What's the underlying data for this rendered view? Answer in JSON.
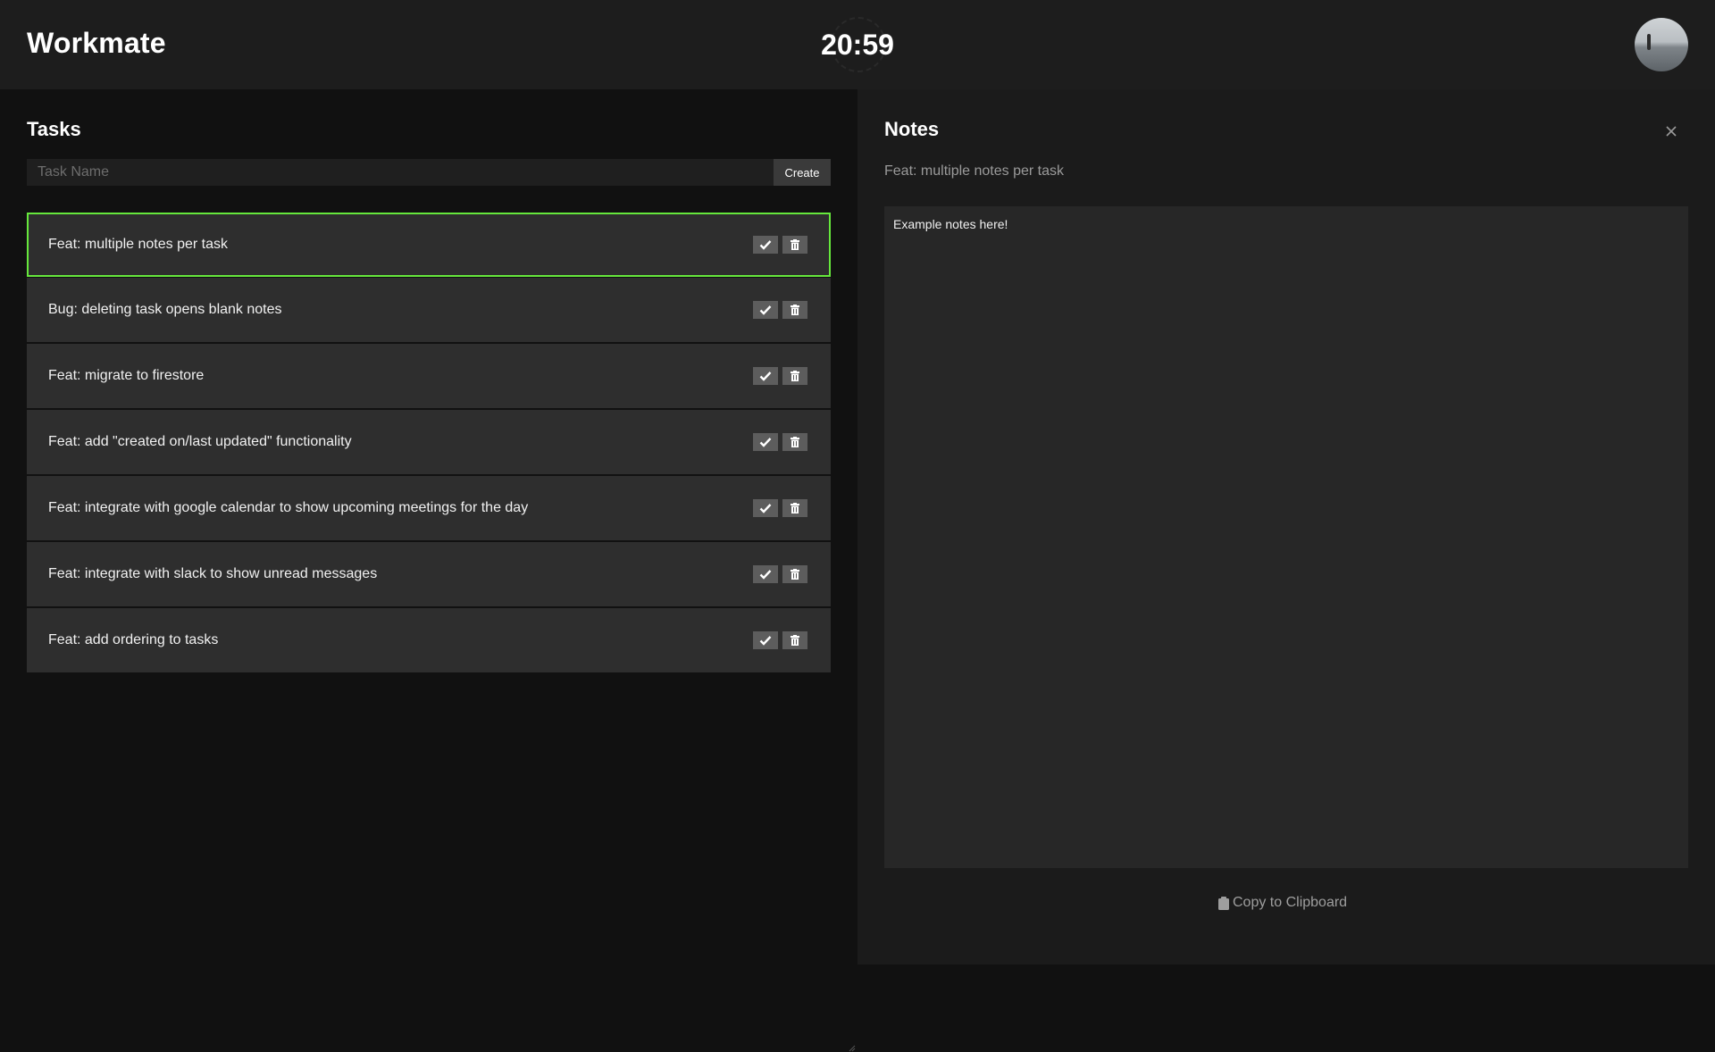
{
  "header": {
    "app_title": "Workmate",
    "clock": "20:59",
    "avatar_icon": "user-avatar-icon"
  },
  "tasks": {
    "title": "Tasks",
    "input_placeholder": "Task Name",
    "input_value": "",
    "create_label": "Create",
    "selected_index": 0,
    "selected_border_color": "#66e83c",
    "items": [
      {
        "label": "Feat: multiple notes per task"
      },
      {
        "label": "Bug: deleting task opens blank notes"
      },
      {
        "label": "Feat: migrate to firestore"
      },
      {
        "label": "Feat: add \"created on/last updated\" functionality"
      },
      {
        "label": "Feat: integrate with google calendar to show upcoming meetings for the day"
      },
      {
        "label": "Feat: integrate with slack to show unread messages"
      },
      {
        "label": "Feat: add ordering to tasks"
      }
    ],
    "row_icons": [
      "check-icon",
      "trash-icon"
    ]
  },
  "notes": {
    "title": "Notes",
    "task_name": "Feat: multiple notes per task",
    "content": "Example notes here!",
    "copy_label": "Copy to Clipboard",
    "close_icon": "close-icon",
    "copy_icon": "clipboard-icon"
  }
}
